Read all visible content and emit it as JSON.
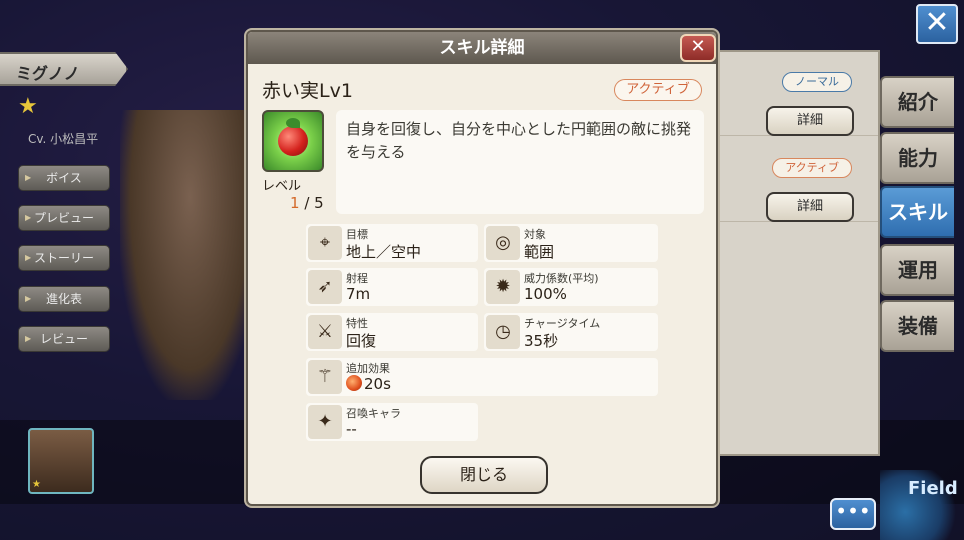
{
  "character": {
    "name": "ミグノノ",
    "cv": "Cv. 小松昌平",
    "menu": [
      {
        "label": "ボイス"
      },
      {
        "label": "プレビュー"
      },
      {
        "label": "ストーリー"
      },
      {
        "label": "進化表"
      },
      {
        "label": "レビュー"
      }
    ]
  },
  "right_tabs": [
    {
      "label": "紹介"
    },
    {
      "label": "能力"
    },
    {
      "label": "スキル"
    },
    {
      "label": "運用"
    },
    {
      "label": "装備"
    }
  ],
  "background_skills": [
    {
      "tag": "ノーマル",
      "button": "詳細"
    },
    {
      "tag": "アクティブ",
      "button": "詳細"
    }
  ],
  "field_label": "Field",
  "chat_label": "•••",
  "close_icon": "✕",
  "modal": {
    "title": "スキル詳細",
    "close_icon": "✕",
    "skill_name": "赤い実Lv1",
    "skill_type": "アクティブ",
    "level_label": "レベル",
    "level_current": "1",
    "level_max": "/ 5",
    "description": "自身を回復し、自分を中心とした円範囲の敵に挑発を与える",
    "stats": {
      "target": {
        "label": "目標",
        "value": "地上／空中"
      },
      "object": {
        "label": "対象",
        "value": "範囲"
      },
      "range": {
        "label": "射程",
        "value": "7m"
      },
      "power": {
        "label": "威力係数(平均)",
        "value": "100%"
      },
      "trait": {
        "label": "特性",
        "value": "回復"
      },
      "charge": {
        "label": "チャージタイム",
        "value": "35秒"
      },
      "extra": {
        "label": "追加効果",
        "value": "20s"
      },
      "summon": {
        "label": "召喚キャラ",
        "value": "--"
      }
    },
    "close_button": "閉じる"
  }
}
